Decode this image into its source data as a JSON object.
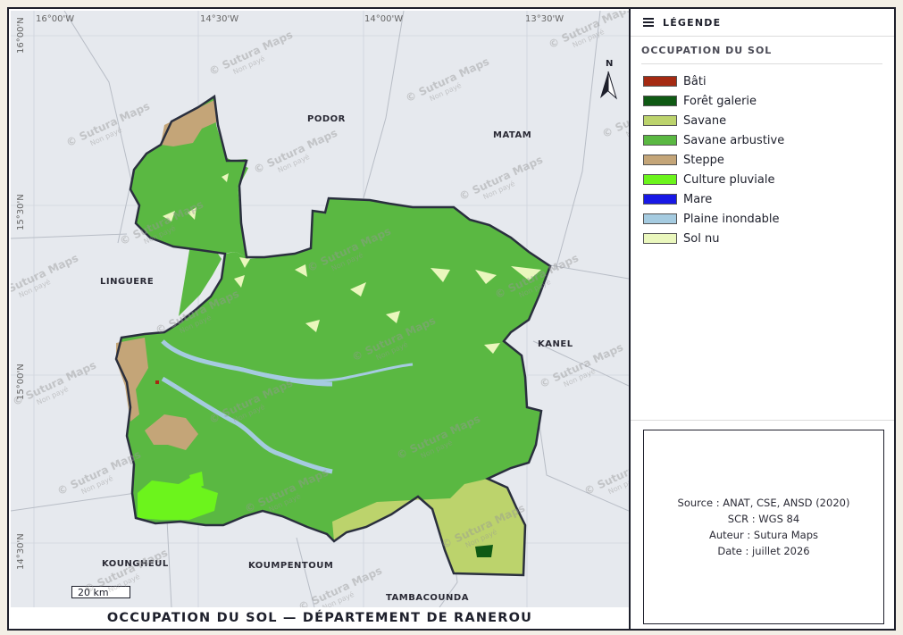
{
  "map": {
    "title": "OCCUPATION DU SOL — DÉPARTEMENT DE RANEROU",
    "lon_ticks": [
      "16°00'W",
      "14°30'W",
      "14°00'W",
      "13°30'W"
    ],
    "lat_ticks": [
      "16°00'N",
      "15°30'N",
      "15°00'N",
      "14°30'N"
    ],
    "places": [
      "PODOR",
      "MATAM",
      "LINGUERE",
      "KANEL",
      "KOUNGHEUL",
      "KOUMPENTOUM",
      "TAMBACOUNDA"
    ],
    "scale_bar": "20 km",
    "north_arrow": "N",
    "watermark": "© Sutura Maps",
    "watermark_sub": "Non payé"
  },
  "legend": {
    "header": "LÉGENDE",
    "section": "OCCUPATION DU SOL",
    "items": [
      {
        "label": "Bâti",
        "color": "#a52a12"
      },
      {
        "label": "Forêt galerie",
        "color": "#0f5a14"
      },
      {
        "label": "Savane",
        "color": "#bcd36c"
      },
      {
        "label": "Savane arbustive",
        "color": "#5ab842"
      },
      {
        "label": "Steppe",
        "color": "#c4a578"
      },
      {
        "label": "Culture pluviale",
        "color": "#6cf41c"
      },
      {
        "label": "Mare",
        "color": "#1818e6"
      },
      {
        "label": "Plaine inondable",
        "color": "#a5cbe0"
      },
      {
        "label": "Sol nu",
        "color": "#eaf7bd"
      }
    ]
  },
  "source": {
    "lines": [
      "Source : ANAT, CSE, ANSD (2020)",
      "SCR : WGS 84",
      "Auteur : Sutura Maps",
      "Date : juillet 2026"
    ]
  }
}
